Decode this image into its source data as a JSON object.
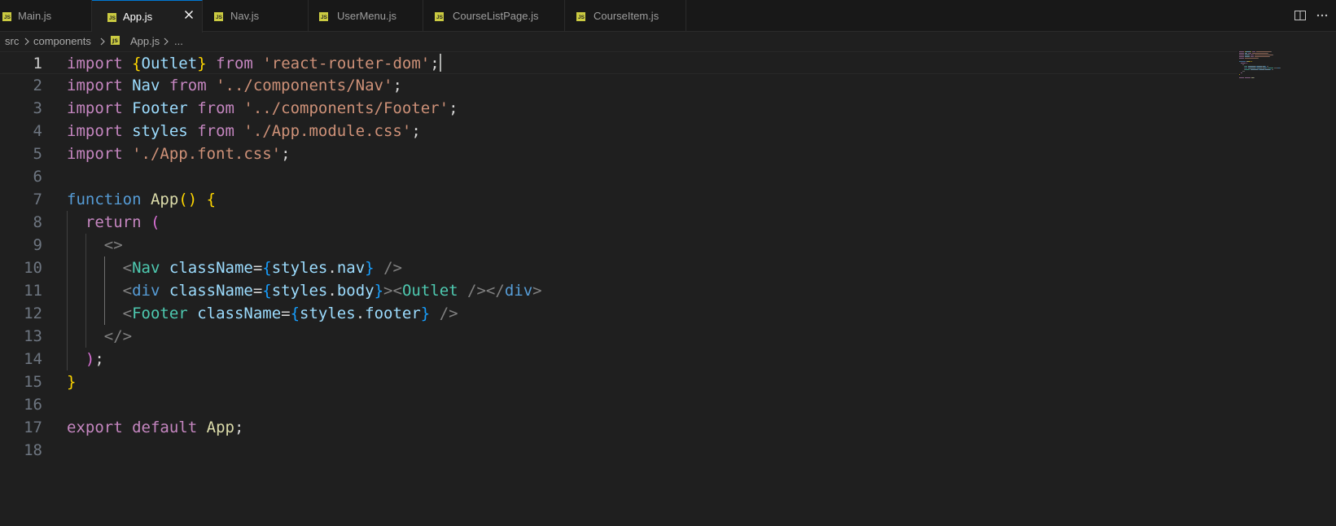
{
  "tabs": [
    {
      "label": "Main.js",
      "active": false,
      "icon": "js-file-icon"
    },
    {
      "label": "App.js",
      "active": true,
      "icon": "js-file-icon"
    },
    {
      "label": "Nav.js",
      "active": false,
      "icon": "js-file-icon"
    },
    {
      "label": "UserMenu.js",
      "active": false,
      "icon": "js-file-icon"
    },
    {
      "label": "CourseListPage.js",
      "active": false,
      "icon": "js-file-icon"
    },
    {
      "label": "CourseItem.js",
      "active": false,
      "icon": "js-file-icon"
    }
  ],
  "file_badge": "JS",
  "toolbar": {
    "split_icon": "split-editor-icon",
    "more_icon": "more-actions-icon"
  },
  "breadcrumb": {
    "segments": [
      "src",
      "components",
      "App.js"
    ],
    "ellipsis": "..."
  },
  "editor": {
    "active_line": 1,
    "line_numbers": [
      "1",
      "2",
      "3",
      "4",
      "5",
      "6",
      "7",
      "8",
      "9",
      "10",
      "11",
      "12",
      "13",
      "14",
      "15",
      "16",
      "17",
      "18"
    ],
    "lines": [
      [
        [
          "k",
          "import"
        ],
        [
          "tx",
          " "
        ],
        [
          "b1",
          "{"
        ],
        [
          "v",
          "Outlet"
        ],
        [
          "b1",
          "}"
        ],
        [
          "tx",
          " "
        ],
        [
          "k",
          "from"
        ],
        [
          "tx",
          " "
        ],
        [
          "s",
          "'react-router-dom'"
        ],
        [
          "tx",
          ";"
        ]
      ],
      [
        [
          "k",
          "import"
        ],
        [
          "tx",
          " "
        ],
        [
          "v",
          "Nav"
        ],
        [
          "tx",
          " "
        ],
        [
          "k",
          "from"
        ],
        [
          "tx",
          " "
        ],
        [
          "s",
          "'../components/Nav'"
        ],
        [
          "tx",
          ";"
        ]
      ],
      [
        [
          "k",
          "import"
        ],
        [
          "tx",
          " "
        ],
        [
          "v",
          "Footer"
        ],
        [
          "tx",
          " "
        ],
        [
          "k",
          "from"
        ],
        [
          "tx",
          " "
        ],
        [
          "s",
          "'../components/Footer'"
        ],
        [
          "tx",
          ";"
        ]
      ],
      [
        [
          "k",
          "import"
        ],
        [
          "tx",
          " "
        ],
        [
          "v",
          "styles"
        ],
        [
          "tx",
          " "
        ],
        [
          "k",
          "from"
        ],
        [
          "tx",
          " "
        ],
        [
          "s",
          "'./App.module.css'"
        ],
        [
          "tx",
          ";"
        ]
      ],
      [
        [
          "k",
          "import"
        ],
        [
          "tx",
          " "
        ],
        [
          "s",
          "'./App.font.css'"
        ],
        [
          "tx",
          ";"
        ]
      ],
      [],
      [
        [
          "kb",
          "function"
        ],
        [
          "tx",
          " "
        ],
        [
          "f",
          "App"
        ],
        [
          "b1",
          "()"
        ],
        [
          "tx",
          " "
        ],
        [
          "b1",
          "{"
        ]
      ],
      [
        [
          "tx",
          "  "
        ],
        [
          "k",
          "return"
        ],
        [
          "tx",
          " "
        ],
        [
          "b2",
          "("
        ]
      ],
      [
        [
          "tx",
          "    "
        ],
        [
          "p",
          "<>"
        ]
      ],
      [
        [
          "tx",
          "      "
        ],
        [
          "p",
          "<"
        ],
        [
          "c",
          "Nav"
        ],
        [
          "tx",
          " "
        ],
        [
          "v",
          "className"
        ],
        [
          "tx",
          "="
        ],
        [
          "b3",
          "{"
        ],
        [
          "v",
          "styles"
        ],
        [
          "tx",
          "."
        ],
        [
          "v",
          "nav"
        ],
        [
          "b3",
          "}"
        ],
        [
          "tx",
          " "
        ],
        [
          "p",
          "/>"
        ]
      ],
      [
        [
          "tx",
          "      "
        ],
        [
          "p",
          "<"
        ],
        [
          "kb",
          "div"
        ],
        [
          "tx",
          " "
        ],
        [
          "v",
          "className"
        ],
        [
          "tx",
          "="
        ],
        [
          "b3",
          "{"
        ],
        [
          "v",
          "styles"
        ],
        [
          "tx",
          "."
        ],
        [
          "v",
          "body"
        ],
        [
          "b3",
          "}"
        ],
        [
          "p",
          ">"
        ],
        [
          "p",
          "<"
        ],
        [
          "c",
          "Outlet"
        ],
        [
          "tx",
          " "
        ],
        [
          "p",
          "/></"
        ],
        [
          "kb",
          "div"
        ],
        [
          "p",
          ">"
        ]
      ],
      [
        [
          "tx",
          "      "
        ],
        [
          "p",
          "<"
        ],
        [
          "c",
          "Footer"
        ],
        [
          "tx",
          " "
        ],
        [
          "v",
          "className"
        ],
        [
          "tx",
          "="
        ],
        [
          "b3",
          "{"
        ],
        [
          "v",
          "styles"
        ],
        [
          "tx",
          "."
        ],
        [
          "v",
          "footer"
        ],
        [
          "b3",
          "}"
        ],
        [
          "tx",
          " "
        ],
        [
          "p",
          "/>"
        ]
      ],
      [
        [
          "tx",
          "    "
        ],
        [
          "p",
          "</>"
        ]
      ],
      [
        [
          "tx",
          "  "
        ],
        [
          "b2",
          ")"
        ],
        [
          "tx",
          ";"
        ]
      ],
      [
        [
          "b1",
          "}"
        ]
      ],
      [],
      [
        [
          "k",
          "export"
        ],
        [
          "tx",
          " "
        ],
        [
          "k",
          "default"
        ],
        [
          "tx",
          " "
        ],
        [
          "f",
          "App"
        ],
        [
          "tx",
          ";"
        ]
      ],
      []
    ]
  },
  "colors": {
    "background": "#1f1f1f",
    "tabbar": "#181818",
    "active_tab_border": "#0078d4",
    "js_badge": "#cbcb41"
  }
}
